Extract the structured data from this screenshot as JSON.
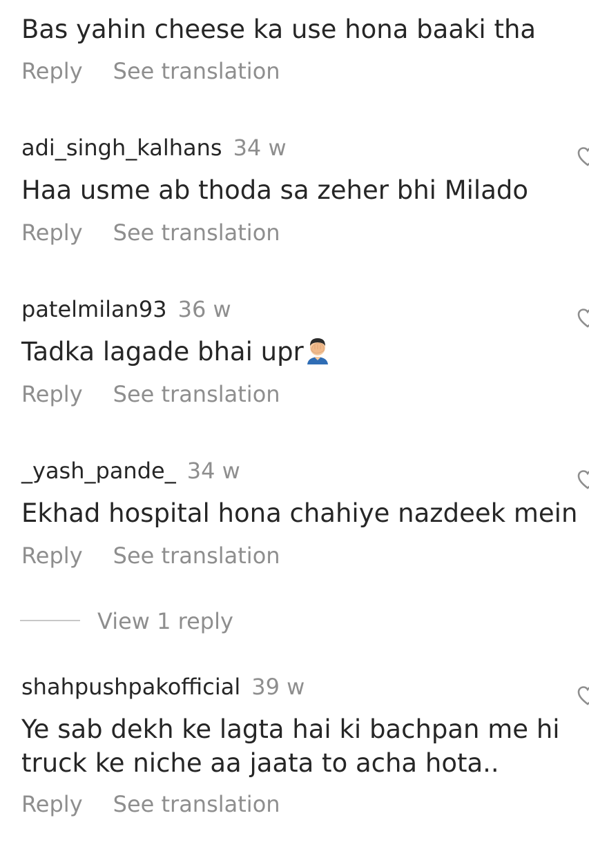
{
  "comments": [
    {
      "username": "",
      "time": "",
      "text": "Bas yahin cheese ka use hona baaki tha",
      "reply_label": "Reply",
      "translate_label": "See translation"
    },
    {
      "username": "adi_singh_kalhans",
      "time": "34 w",
      "text": "Haa usme ab thoda sa zeher bhi Milado",
      "reply_label": "Reply",
      "translate_label": "See translation"
    },
    {
      "username": "patelmilan93",
      "time": "36 w",
      "text": "Tadka lagade bhai upr",
      "emoji": "man-facepalming",
      "reply_label": "Reply",
      "translate_label": "See translation"
    },
    {
      "username": "_yash_pande_",
      "time": "34 w",
      "text": "Ekhad hospital hona chahiye nazdeek mein",
      "reply_label": "Reply",
      "translate_label": "See translation"
    },
    {
      "username": "shahpushpakofficial",
      "time": "39 w",
      "text_line1": "Ye sab dekh ke lagta hai ki bachpan me hi",
      "text_line2": "truck ke niche aa jaata to acha hota..",
      "reply_label": "Reply",
      "translate_label": "See translation"
    }
  ],
  "view_replies_label": "View 1 reply",
  "icons": {
    "like": "heart-outline-icon"
  },
  "colors": {
    "primary_text": "#262626",
    "secondary_text": "#8e8e8e",
    "divider": "#c7c7c7"
  }
}
